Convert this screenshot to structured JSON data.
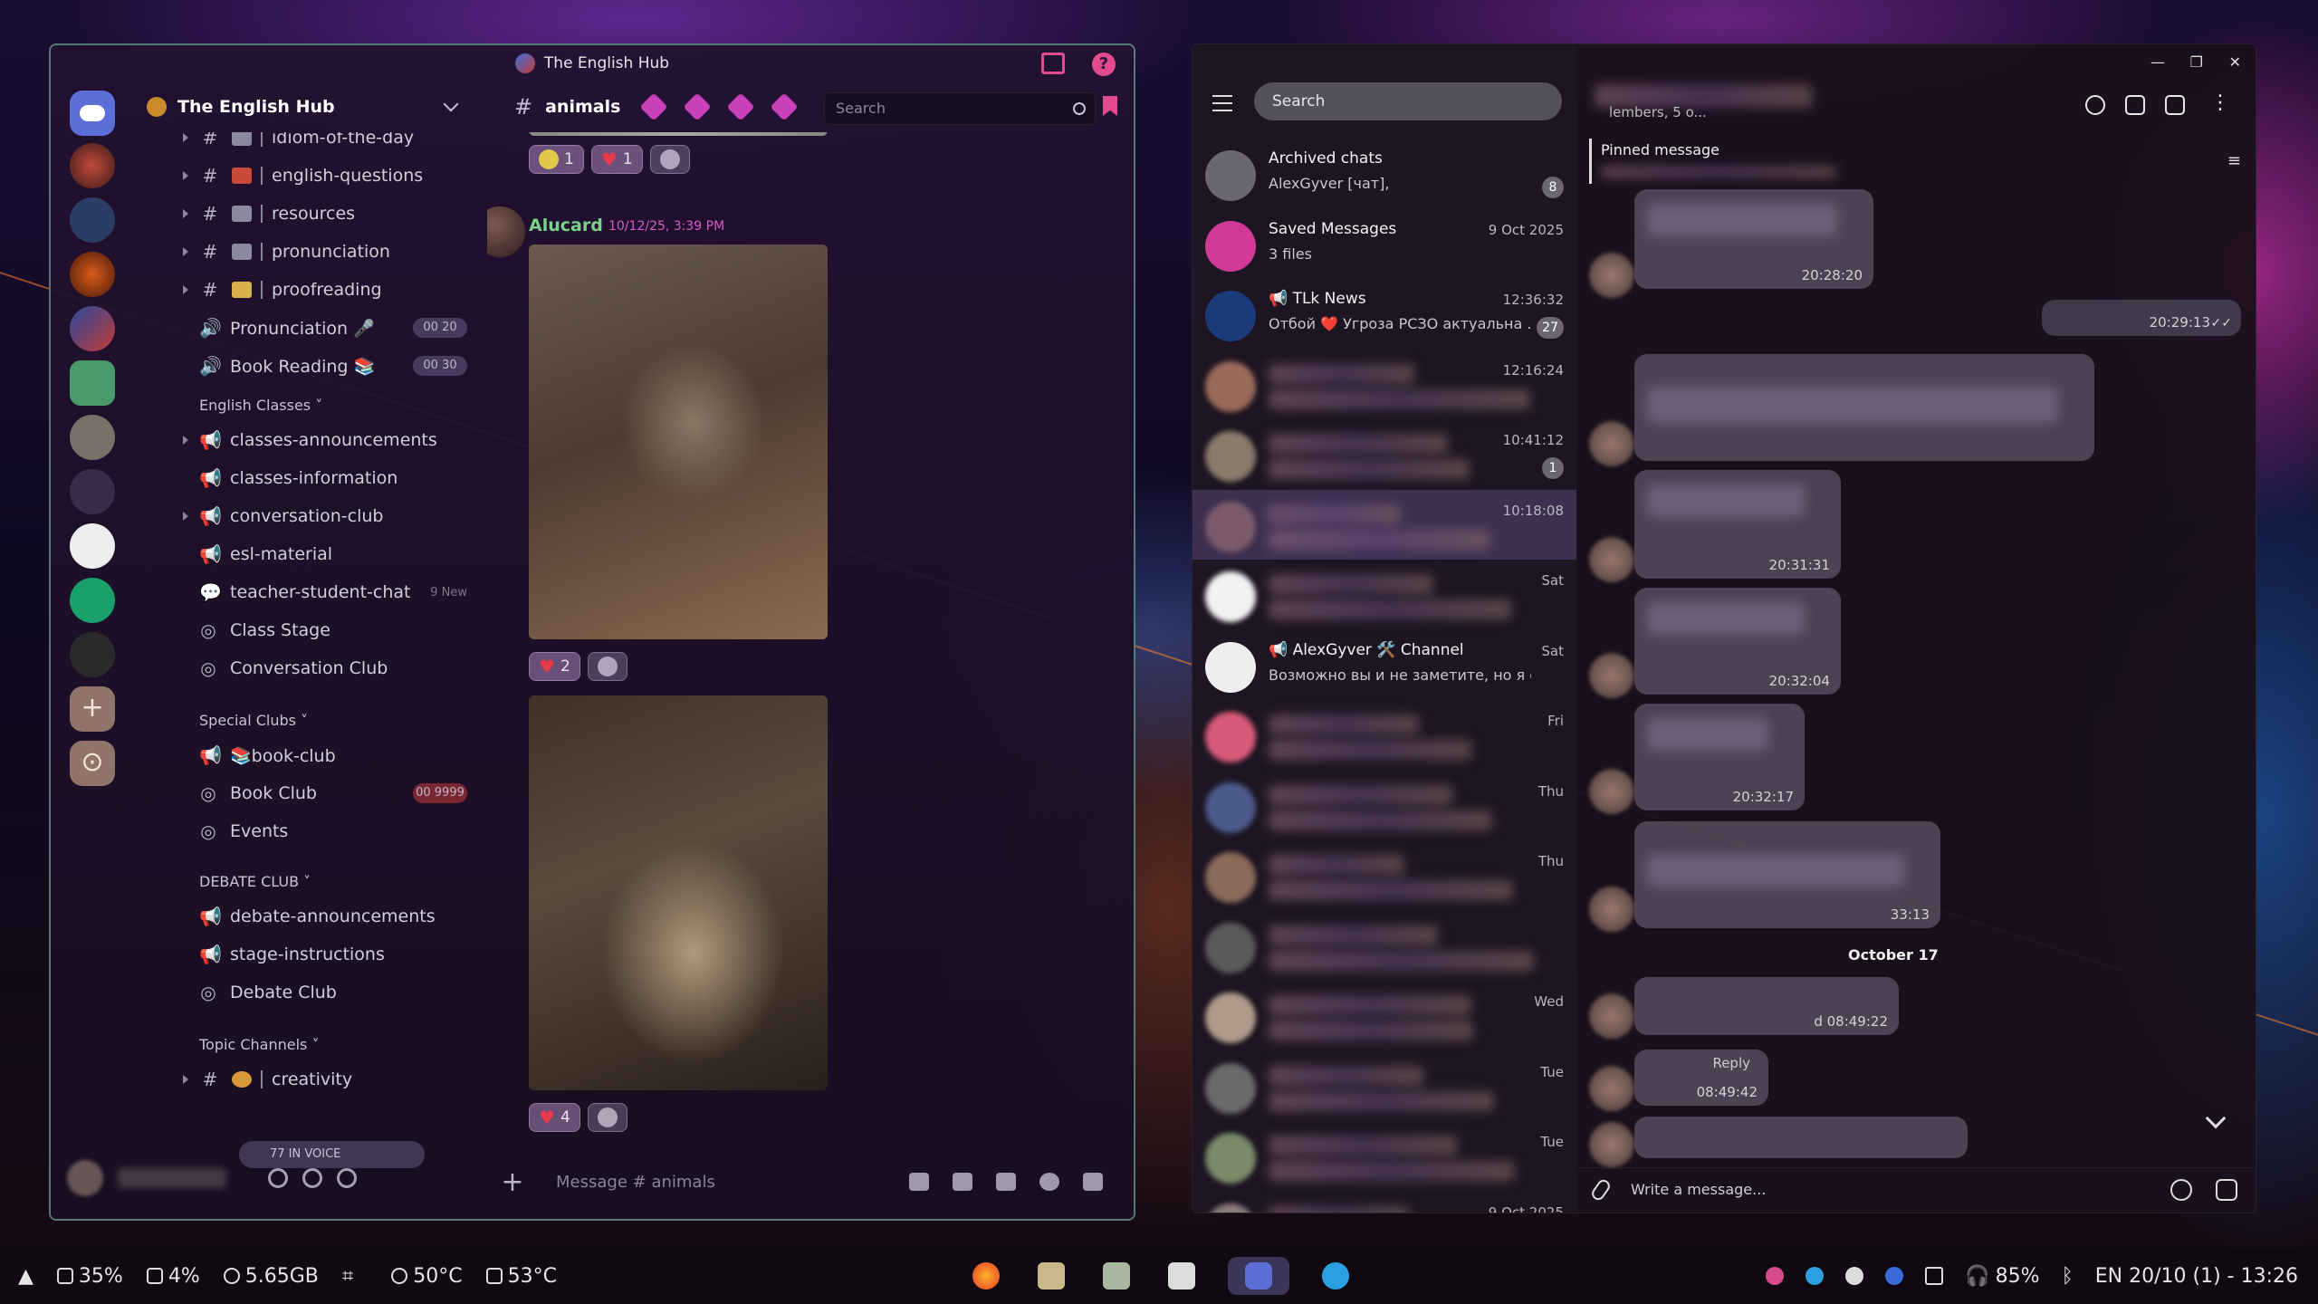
{
  "colors": {
    "accent_pink": "#e24a8e",
    "green_author": "#7bd28c",
    "border_teal": "#82d2b4"
  },
  "discord": {
    "window_title": "The English Hub",
    "server_name": "The English Hub",
    "channel_name": "animals",
    "search_placeholder": "Search",
    "input_placeholder": "Message #",
    "input_channel": "animals",
    "voice_pill": "77 IN VOICE",
    "channels": [
      {
        "kind": "text",
        "label": "idiom-of-the-day",
        "icon": "idiom-emoji"
      },
      {
        "kind": "text",
        "label": "english-questions",
        "icon": "books-emoji"
      },
      {
        "kind": "text",
        "label": "resources",
        "icon": "resources-emoji"
      },
      {
        "kind": "text",
        "label": "pronunciation",
        "icon": "memo-emoji"
      },
      {
        "kind": "text",
        "label": "proofreading",
        "icon": "pencil-emoji"
      },
      {
        "kind": "voice",
        "label": "Pronunciation 🎤",
        "badge": "00 20"
      },
      {
        "kind": "voice",
        "label": "Book Reading 📚",
        "badge": "00 30"
      }
    ],
    "categories": {
      "english_classes": "English Classes",
      "special_clubs": "Special Clubs",
      "debate_club": "DEBATE CLUB",
      "topic_channels": "Topic Channels"
    },
    "english_classes": [
      "classes-announcements",
      "classes-information",
      "conversation-club",
      "esl-material",
      "teacher-student-chat",
      "Class Stage",
      "Conversation Club"
    ],
    "teacher_new": "9 New",
    "special_clubs": [
      "📚book-club",
      "Book Club",
      "Events"
    ],
    "book_club_badge": "00 9999",
    "debate_club": [
      "debate-announcements",
      "stage-instructions",
      "Debate Club"
    ],
    "topic_channels": [
      "creativity"
    ],
    "message": {
      "author": "Alucard",
      "time": "10/12/25, 3:39 PM"
    },
    "reactions_top": [
      "1",
      "1"
    ],
    "reactions_mid": [
      "2"
    ],
    "reactions_bot": [
      "4"
    ]
  },
  "telegram": {
    "search_placeholder": "Search",
    "pinned_label": "Pinned message",
    "members_stub": "lembers, 5 o...",
    "chats": [
      {
        "name": "Archived chats",
        "preview": "AlexGyver [чат],",
        "time": "",
        "badge": "8"
      },
      {
        "name": "Saved Messages",
        "preview": "3 files",
        "time": "9 Oct 2025",
        "badge": ""
      },
      {
        "name": "📢 TLk News",
        "preview": "Отбой ❤️ Угроза РСЗО актуальна ...",
        "time": "12:36:32",
        "badge": "27"
      },
      {
        "name": "",
        "preview": "",
        "time": "12:16:24",
        "badge": ""
      },
      {
        "name": "",
        "preview": "",
        "time": "10:41:12",
        "badge": "1"
      },
      {
        "name": "",
        "preview": "",
        "time": "10:18:08",
        "badge": ""
      },
      {
        "name": "",
        "preview": "",
        "time": "Sat",
        "badge": ""
      },
      {
        "name": "📢 AlexGyver 🛠️ Channel",
        "preview": "Возможно вы и не заметите, но я сл...",
        "time": "Sat",
        "badge": ""
      },
      {
        "name": "",
        "preview": "",
        "time": "Fri",
        "badge": ""
      },
      {
        "name": "",
        "preview": "",
        "time": "Thu",
        "badge": ""
      },
      {
        "name": "",
        "preview": "",
        "time": "Thu",
        "badge": ""
      },
      {
        "name": "",
        "preview": "",
        "time": "",
        "badge": ""
      },
      {
        "name": "",
        "preview": "",
        "time": "Wed",
        "badge": ""
      },
      {
        "name": "",
        "preview": "",
        "time": "Tue",
        "badge": ""
      },
      {
        "name": "",
        "preview": "",
        "time": "Tue",
        "badge": ""
      },
      {
        "name": "",
        "preview": "",
        "time": "9 Oct 2025",
        "badge": ""
      }
    ],
    "bubble_times": [
      "20:28:20",
      "20:29:13",
      "20:31:31",
      "20:32:04",
      "20:32:17",
      "33:13",
      "d 08:49:22",
      "08:49:42"
    ],
    "reply_label": "Reply",
    "day_separator": "October 17",
    "input_placeholder": "Write a message..."
  },
  "taskbar": {
    "cpu": "35%",
    "gpu": "4%",
    "ram": "5.65GB",
    "temp_cpu": "50°C",
    "temp_gpu": "53°C",
    "battery": "85%",
    "locale_time": "EN  20/10 (1) - 13:26"
  }
}
